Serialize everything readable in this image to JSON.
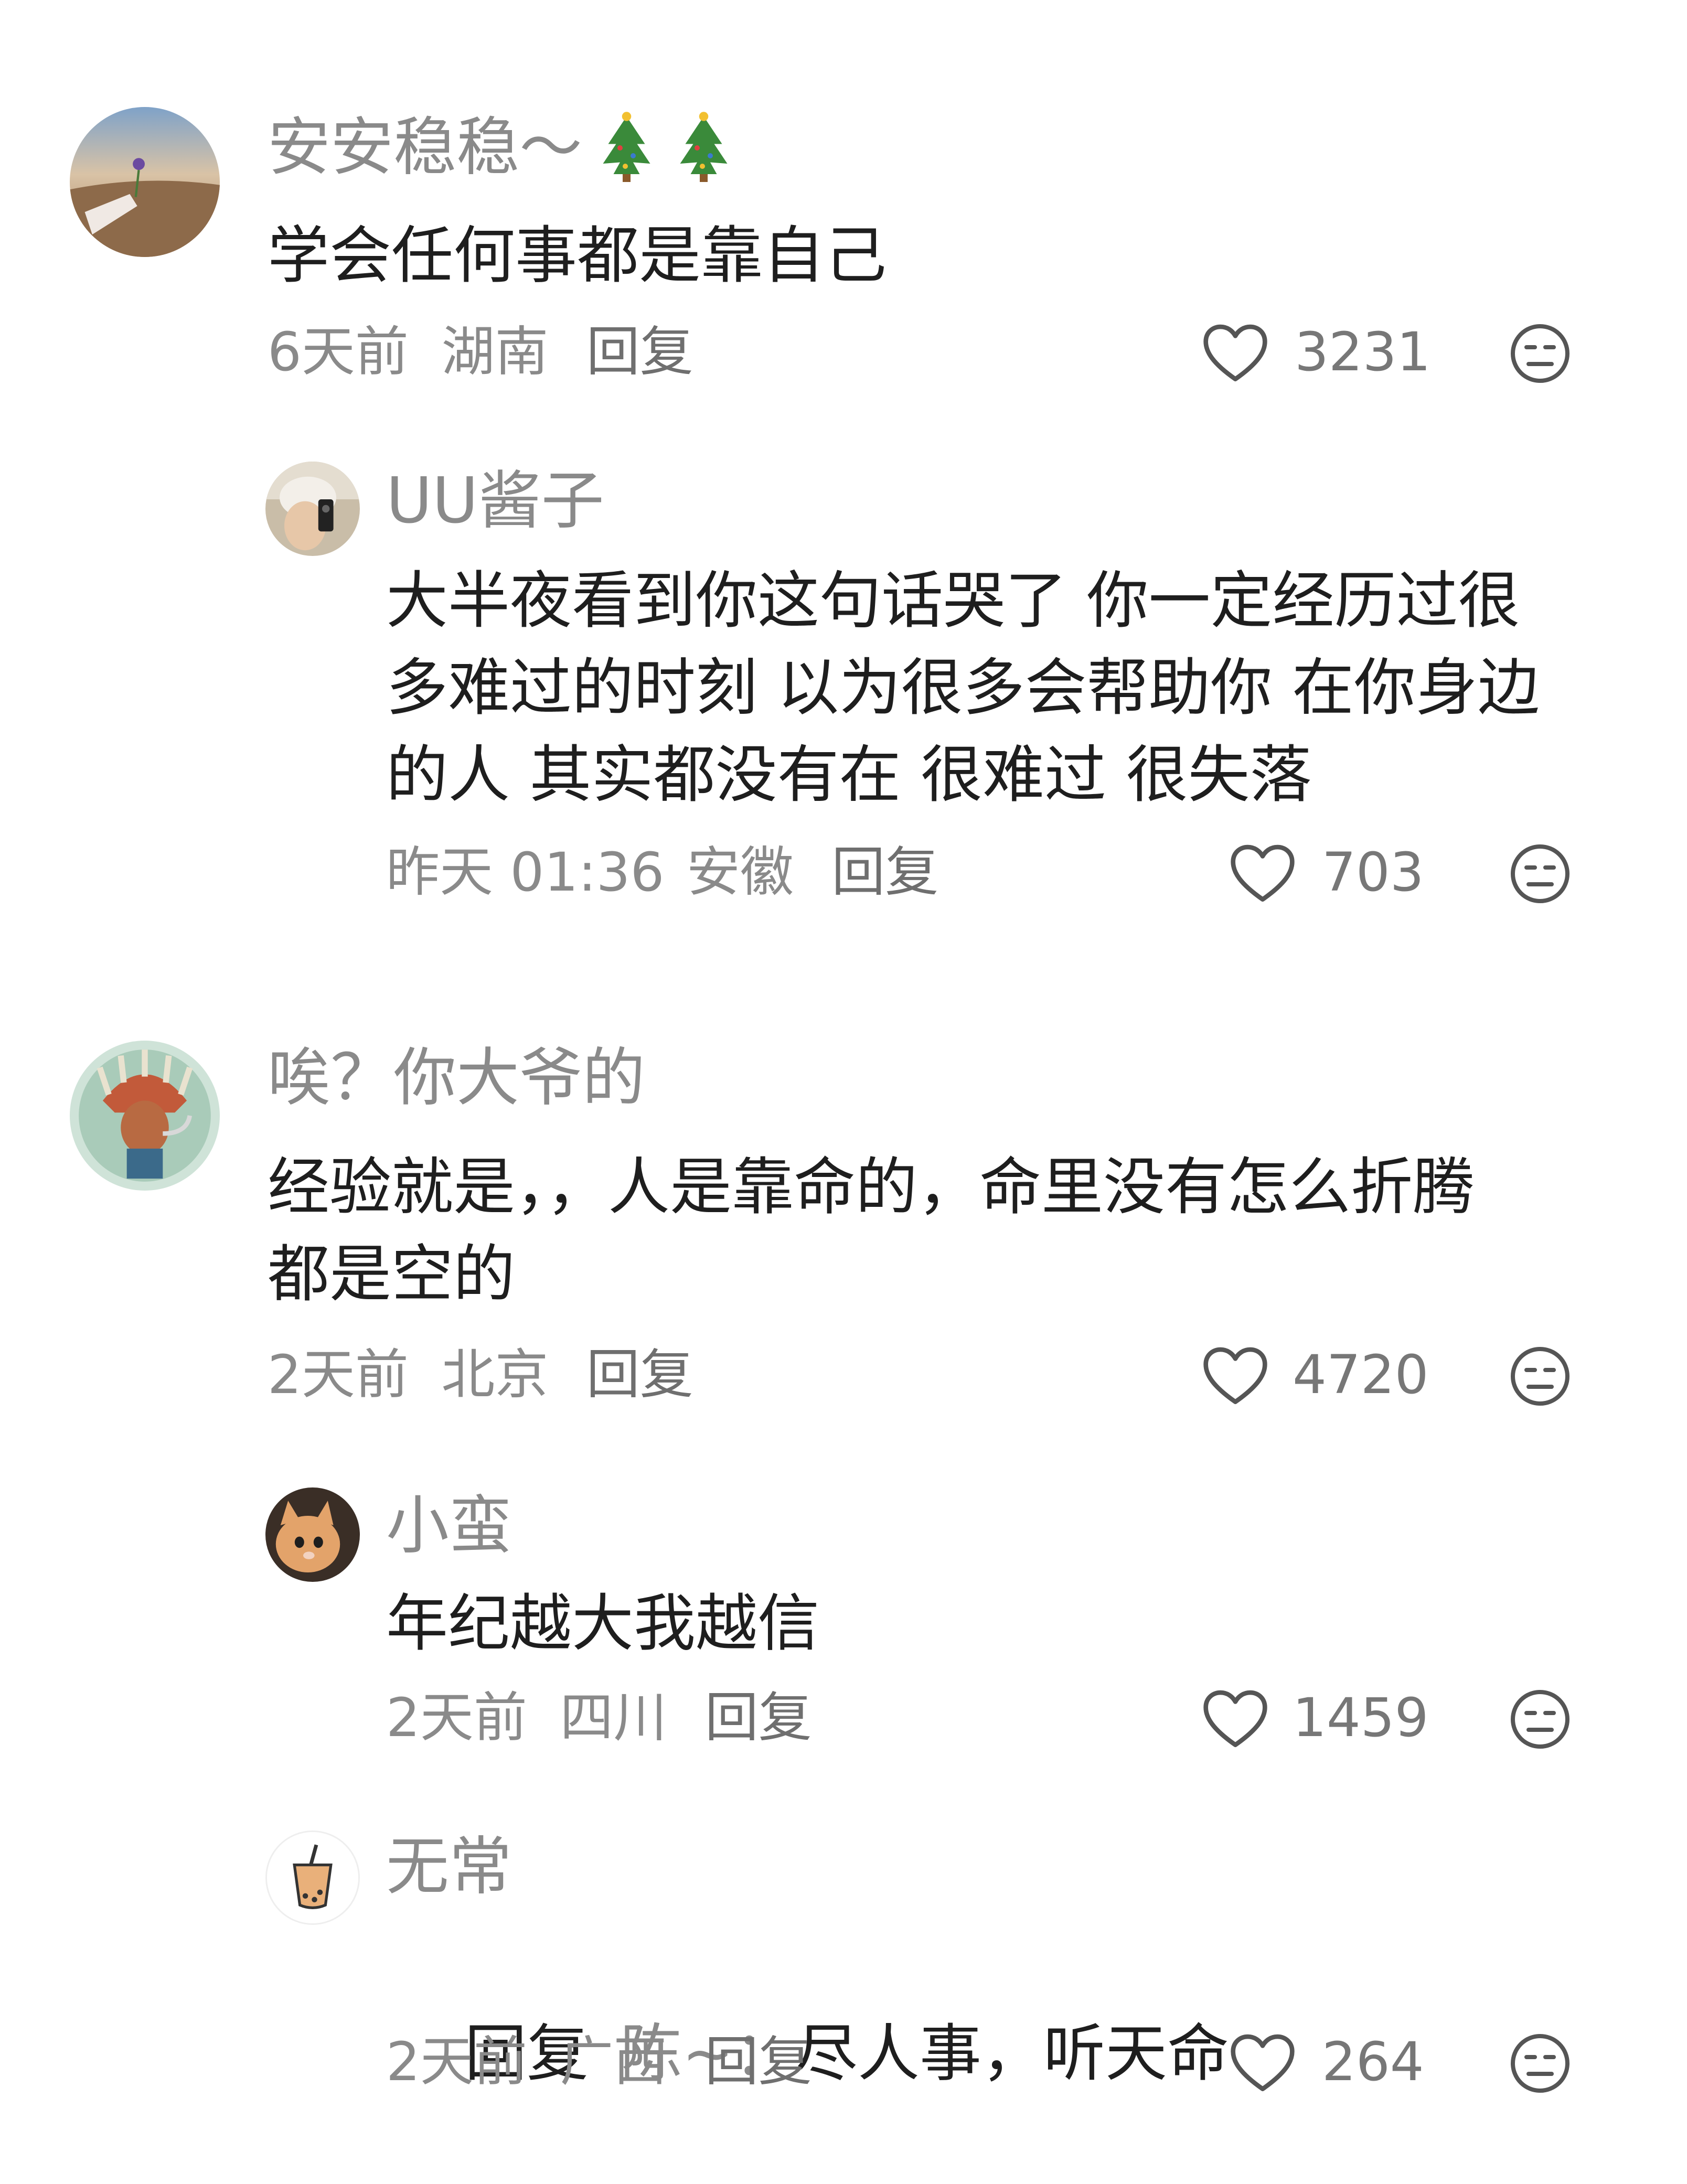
{
  "comments": [
    {
      "username": "安安稳稳～",
      "username_emoji": "🎄🎄",
      "text": "学会任何事都是靠自己",
      "time": "6天前",
      "location": "湖南",
      "reply_label": "回复",
      "likes": "3231"
    },
    {
      "username": "UU酱子",
      "text": "大半夜看到你这句话哭了 你一定经历过很\n多难过的时刻 以为很多会帮助你 在你身边\n的人 其实都没有在 很难过 很失落",
      "time": "昨天 01:36",
      "location": "安徽",
      "reply_label": "回复",
      "likes": "703"
    },
    {
      "username": "唉？你大爷的",
      "text": "经验就是，，人是靠命的，命里没有怎么折腾\n都是空的",
      "time": "2天前",
      "location": "北京",
      "reply_label": "回复",
      "likes": "4720"
    },
    {
      "username": "小蛮",
      "text": "年纪越大我越信",
      "time": "2天前",
      "location": "四川",
      "reply_label": "回复",
      "likes": "1459"
    },
    {
      "username": "无常",
      "reply_prefix": "回复",
      "reply_target": "陈~：",
      "text": "尽人事，听天命",
      "time": "2天前",
      "location": "广西",
      "reply_label": "回复",
      "likes": "264"
    }
  ],
  "icons": {
    "like": "heart-outline-icon",
    "dislike": "neutral-face-icon",
    "emoji": "christmas-tree-icon"
  },
  "colors": {
    "username": "#8a8a8a",
    "text": "#1e1e1e",
    "meta": "#8a8a8a",
    "icon": "#555555",
    "background": "#ffffff"
  }
}
